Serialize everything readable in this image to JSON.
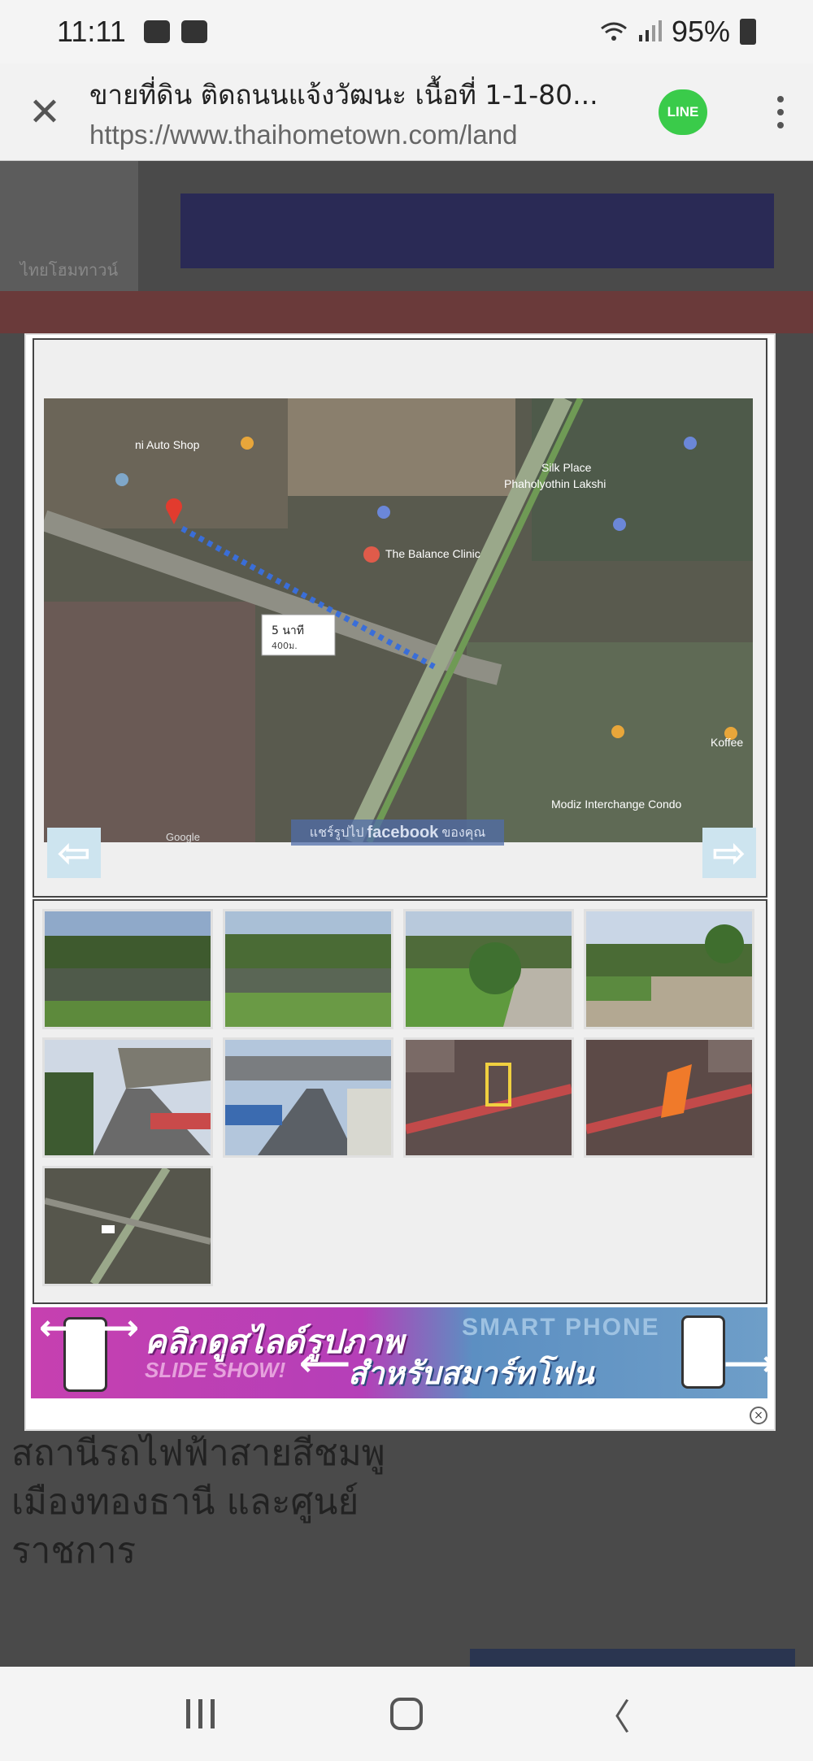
{
  "status_bar": {
    "time": "11:11",
    "battery": "95%",
    "icons": [
      "gallery-icon",
      "youtube-icon",
      "wifi-icon",
      "signal-icon",
      "battery-icon"
    ]
  },
  "browser": {
    "page_title": "ขายที่ดิน ติดถนนแจ้งวัฒนะ เนื้อที่ 1-1-80...",
    "url": "https://www.thaihometown.com/land",
    "line_label": "LINE"
  },
  "background_page": {
    "logo_text": "ไทยโฮมทาวน์",
    "heading": "สถานีรถไฟฟ้าสายสีชมพู เมืองทองธานี และศูนย์ราชการ"
  },
  "viewer": {
    "map_labels": [
      "ni Auto Shop",
      "Silk Place",
      "Phaholyothin Lakshi",
      "The Balance Clinic",
      "Modiz Interchange Condo",
      "Koffee",
      "Google"
    ],
    "route_time": "5 นาที",
    "route_distance": "400ม.",
    "share": {
      "prefix": "แชร์รูปไป",
      "brand": "facebook",
      "suffix": "ของคุณ"
    }
  },
  "thumbnails": [
    {
      "kind": "pond-1",
      "color": "#4d6e3b"
    },
    {
      "kind": "pond-2",
      "color": "#5b7a42"
    },
    {
      "kind": "lawn-path",
      "color": "#5f8a3e"
    },
    {
      "kind": "garden-path",
      "color": "#6d8f4f"
    },
    {
      "kind": "road-skytrain-1",
      "color": "#8a8f99"
    },
    {
      "kind": "road-skytrain-2",
      "color": "#7b8696"
    },
    {
      "kind": "map-plot-1",
      "color": "#6b5a55"
    },
    {
      "kind": "map-plot-2",
      "color": "#6e5852"
    },
    {
      "kind": "aerial-map",
      "color": "#56564c"
    }
  ],
  "slide_banner": {
    "line1": "คลิกดูสไลด์รูปภาพ",
    "slideshow": "SLIDE SHOW!",
    "smartphone": "SMART PHONE",
    "line2": "สำหรับสมาร์ทโฟน"
  },
  "modal": {
    "close_symbol": "×"
  }
}
